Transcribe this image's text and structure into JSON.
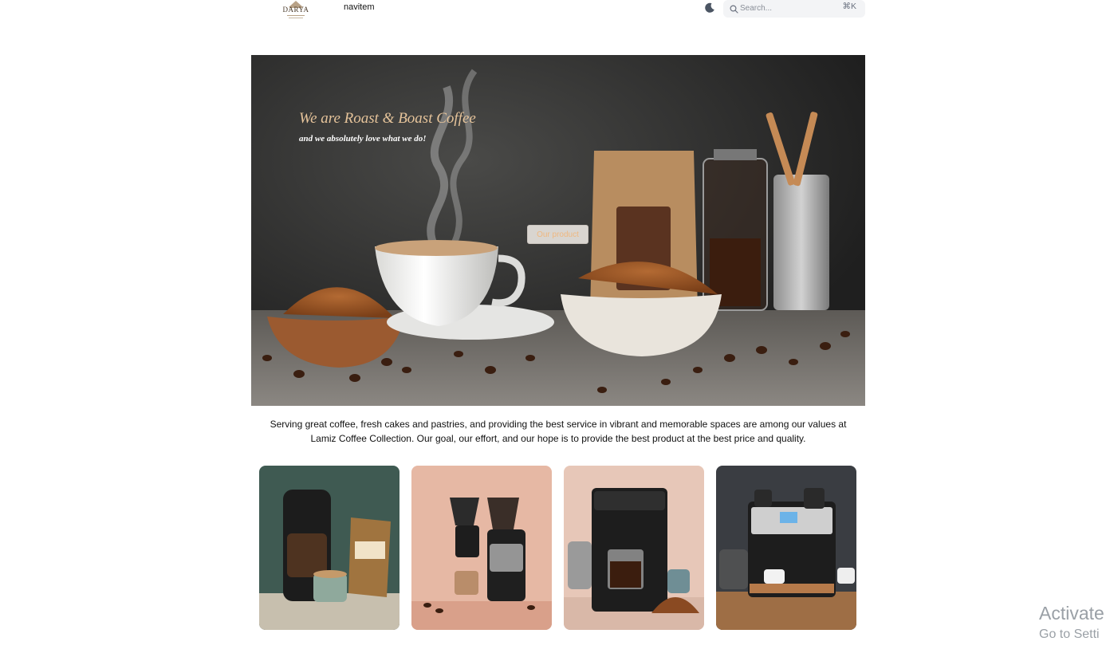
{
  "header": {
    "logo_text": "DARYA",
    "nav_label": "navitem",
    "theme_icon": "moon-icon",
    "search": {
      "placeholder": "Search...",
      "shortcut": "⌘K",
      "icon": "search-icon"
    }
  },
  "hero": {
    "title": "We are Roast & Boast Coffee",
    "subtitle": "and we absolutely love what we do!",
    "cta_label": "Our product"
  },
  "description": "Serving great coffee, fresh cakes and pastries, and providing the best service in vibrant and memorable spaces are among our values at Lamiz Coffee Collection. Our goal, our effort, and our hope is to provide the best product at the best price and quality.",
  "products": [
    {
      "name": "drip coffee maker with coffee bag"
    },
    {
      "name": "pour-over coffee maker"
    },
    {
      "name": "black drip coffee machine"
    },
    {
      "name": "espresso machine"
    }
  ],
  "os_watermark": {
    "line1": "Activate",
    "line2": "Go to Setti"
  },
  "colors": {
    "title_accent": "#e5c39a",
    "cta_text": "#efb880",
    "page_bg": "#ffffff"
  }
}
